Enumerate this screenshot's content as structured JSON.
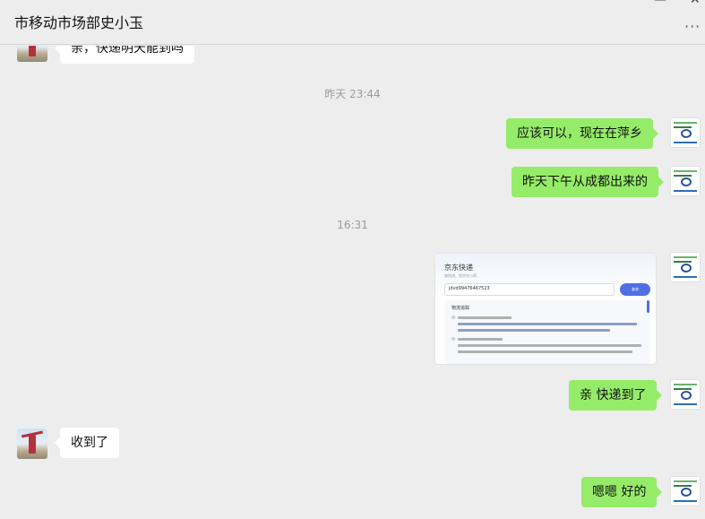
{
  "window": {
    "title": "市移动市场部史小玉",
    "minimize_glyph": "—",
    "close_glyph": "✕",
    "more_glyph": "···"
  },
  "timestamps": [
    "昨天 23:44",
    "16:31"
  ],
  "messages": [
    {
      "from": "other",
      "text": "亲，快递明天能到吗"
    },
    {
      "from": "me",
      "text": "应该可以，现在在萍乡"
    },
    {
      "from": "me",
      "text": "昨天下午从成都出来的"
    },
    {
      "from": "me",
      "type": "image",
      "icon": "shipment-screenshot"
    },
    {
      "from": "me",
      "text": "亲 快递到了"
    },
    {
      "from": "other",
      "text": "收到了"
    },
    {
      "from": "me",
      "text": "嗯嗯 好的"
    }
  ],
  "screenshot": {
    "title": "京东快递",
    "subtitle": "查快递、找京东小哥",
    "tracking_number": "jdvd99476467523",
    "button_label": "查询",
    "section_label": "物流追踪"
  },
  "colors": {
    "background": "#ededed",
    "bubble_me": "#95ec69",
    "bubble_other": "#ffffff",
    "timestamp": "#9a9a9a",
    "accent_button": "#4f6fe3"
  }
}
